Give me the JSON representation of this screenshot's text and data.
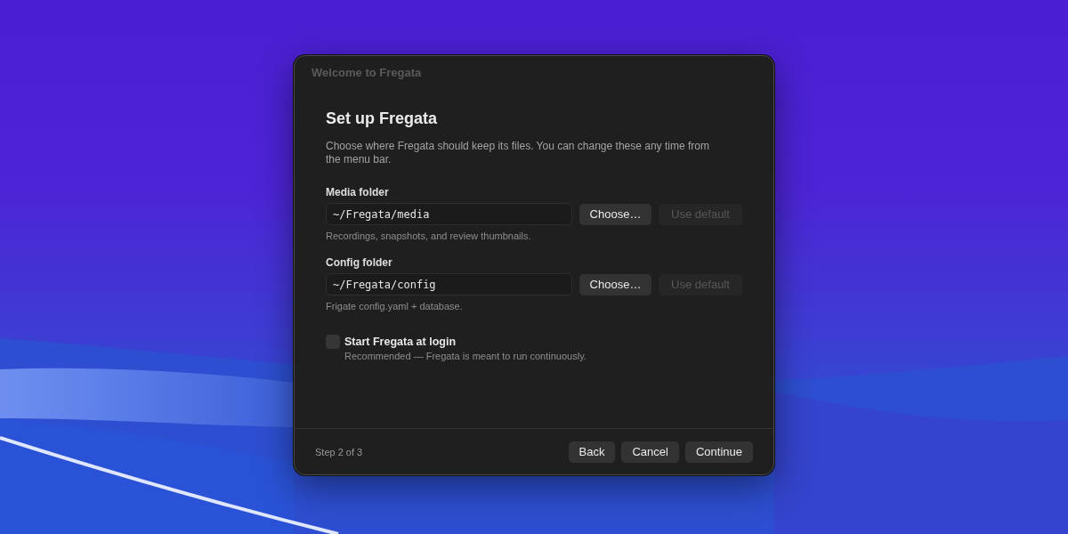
{
  "window": {
    "title": "Welcome to Fregata"
  },
  "heading": "Set up Fregata",
  "description": "Choose where Fregata should keep its files. You can change these any time from the menu bar.",
  "folders": [
    {
      "label": "Media folder",
      "value": "~/Fregata/media",
      "choose_button": {
        "label": "Choose…",
        "disabled": false
      },
      "default_button": {
        "label": "Use default",
        "disabled": true
      },
      "hint": "Recordings, snapshots, and review thumbnails."
    },
    {
      "label": "Config folder",
      "value": "~/Fregata/config",
      "choose_button": {
        "label": "Choose…",
        "disabled": false
      },
      "default_button": {
        "label": "Use default",
        "disabled": true
      },
      "hint": "Frigate config.yaml + database."
    }
  ],
  "login_option": {
    "label": "Start Fregata at login",
    "checked": false,
    "hint": "Recommended — Fregata is meant to run continuously."
  },
  "footer": {
    "step": "Step 2 of 3",
    "buttons": [
      "Back",
      "Cancel",
      "Continue"
    ]
  }
}
